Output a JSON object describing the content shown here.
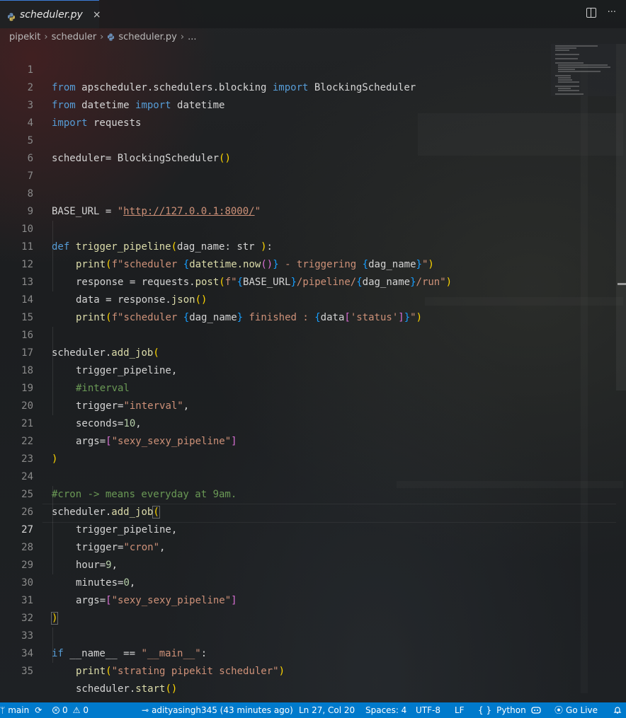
{
  "tab": {
    "title": "scheduler.py",
    "close_glyph": "×"
  },
  "tab_actions": {
    "split_icon": "split-editor-icon",
    "more_glyph": "···"
  },
  "breadcrumb": {
    "items": [
      "pipekit",
      "scheduler",
      "scheduler.py",
      "..."
    ],
    "separator": "›"
  },
  "editor": {
    "active_line": 27,
    "lines": [
      {
        "n": "1"
      },
      {
        "n": "2"
      },
      {
        "n": "3"
      },
      {
        "n": "4"
      },
      {
        "n": "5"
      },
      {
        "n": "6"
      },
      {
        "n": "7"
      },
      {
        "n": "8"
      },
      {
        "n": "9"
      },
      {
        "n": "10"
      },
      {
        "n": "11"
      },
      {
        "n": "12"
      },
      {
        "n": "13"
      },
      {
        "n": "14"
      },
      {
        "n": "15"
      },
      {
        "n": "16"
      },
      {
        "n": "17"
      },
      {
        "n": "18"
      },
      {
        "n": "19"
      },
      {
        "n": "20"
      },
      {
        "n": "21"
      },
      {
        "n": "22"
      },
      {
        "n": "23"
      },
      {
        "n": "24"
      },
      {
        "n": "25"
      },
      {
        "n": "26"
      },
      {
        "n": "27"
      },
      {
        "n": "28"
      },
      {
        "n": "29"
      },
      {
        "n": "30"
      },
      {
        "n": "31"
      },
      {
        "n": "32"
      },
      {
        "n": "33"
      },
      {
        "n": "34"
      },
      {
        "n": "35"
      }
    ],
    "tokens": {
      "l1": [
        "from",
        " apscheduler.schedulers.blocking ",
        "import",
        " BlockingScheduler"
      ],
      "l2": [
        "from",
        " datetime ",
        "import",
        " datetime"
      ],
      "l3": [
        "import",
        " requests"
      ],
      "l5": [
        "scheduler= ",
        "BlockingScheduler",
        "()"
      ],
      "l8": [
        "BASE_URL = ",
        "\"",
        "http://127.0.0.1:8000/",
        "\""
      ],
      "l10": [
        "def",
        " ",
        "trigger_pipeline",
        "(",
        "dag_name",
        ": ",
        "str",
        " ",
        ")",
        ":"
      ],
      "l11": [
        "print",
        "(",
        "f\"scheduler ",
        "{",
        "datetime.now",
        "()",
        "}",
        " - triggering ",
        "{",
        "dag_name",
        "}",
        "\"",
        ")"
      ],
      "l12": [
        "response = requests.",
        "post",
        "(",
        "f\"",
        "{",
        "BASE_URL",
        "}",
        "/pipeline/",
        "{",
        "dag_name",
        "}",
        "/run\"",
        ")"
      ],
      "l13": [
        "data = response.",
        "json",
        "()"
      ],
      "l14": [
        "print",
        "(",
        "f\"scheduler ",
        "{",
        "dag_name",
        "}",
        " finished : ",
        "{",
        "data",
        "[",
        "'status'",
        "]",
        "}",
        "\"",
        ")"
      ],
      "l16": [
        "scheduler.",
        "add_job",
        "("
      ],
      "l17": [
        "trigger_pipeline,"
      ],
      "l18": [
        "#interval"
      ],
      "l19": [
        "trigger=",
        "\"interval\"",
        ","
      ],
      "l20": [
        "seconds=",
        "10",
        ","
      ],
      "l21": [
        "args=",
        "[",
        "\"sexy_sexy_pipeline\"",
        "]"
      ],
      "l22": [
        ")"
      ],
      "l24": [
        "#cron -> means everyday at 9am."
      ],
      "l25": [
        "scheduler.",
        "add_job",
        "("
      ],
      "l26": [
        "trigger_pipeline,"
      ],
      "l27": [
        "trigger=",
        "\"cron\"",
        ","
      ],
      "l28": [
        "hour=",
        "9",
        ","
      ],
      "l29": [
        "minutes=",
        "0",
        ","
      ],
      "l30": [
        "args=",
        "[",
        "\"sexy_sexy_pipeline\"",
        "]"
      ],
      "l31": [
        ")"
      ],
      "l33": [
        "if",
        " __name__ == ",
        "\"__main__\"",
        ":"
      ],
      "l34": [
        "print",
        "(",
        "\"strating pipekit scheduler\"",
        ")"
      ],
      "l35": [
        "scheduler.",
        "start",
        "()"
      ]
    }
  },
  "status_bar": {
    "branch": "main",
    "errors": "0",
    "warnings": "0",
    "commit": "adityasingh345 (43 minutes ago)",
    "cursor": "Ln 27, Col 20",
    "spaces": "Spaces: 4",
    "encoding": "UTF-8",
    "eol": "LF",
    "language_braces": "{ }",
    "language": "Python",
    "go_live": "Go Live"
  },
  "colors": {
    "status_bar": "#007acc",
    "keyword": "#569cd6",
    "function": "#dcdcaa",
    "string": "#ce9178",
    "number": "#b5cea8",
    "comment": "#6a9955",
    "bracket_gold": "#ffd700",
    "bracket_violet": "#da70d6",
    "bracket_blue": "#179fff"
  }
}
